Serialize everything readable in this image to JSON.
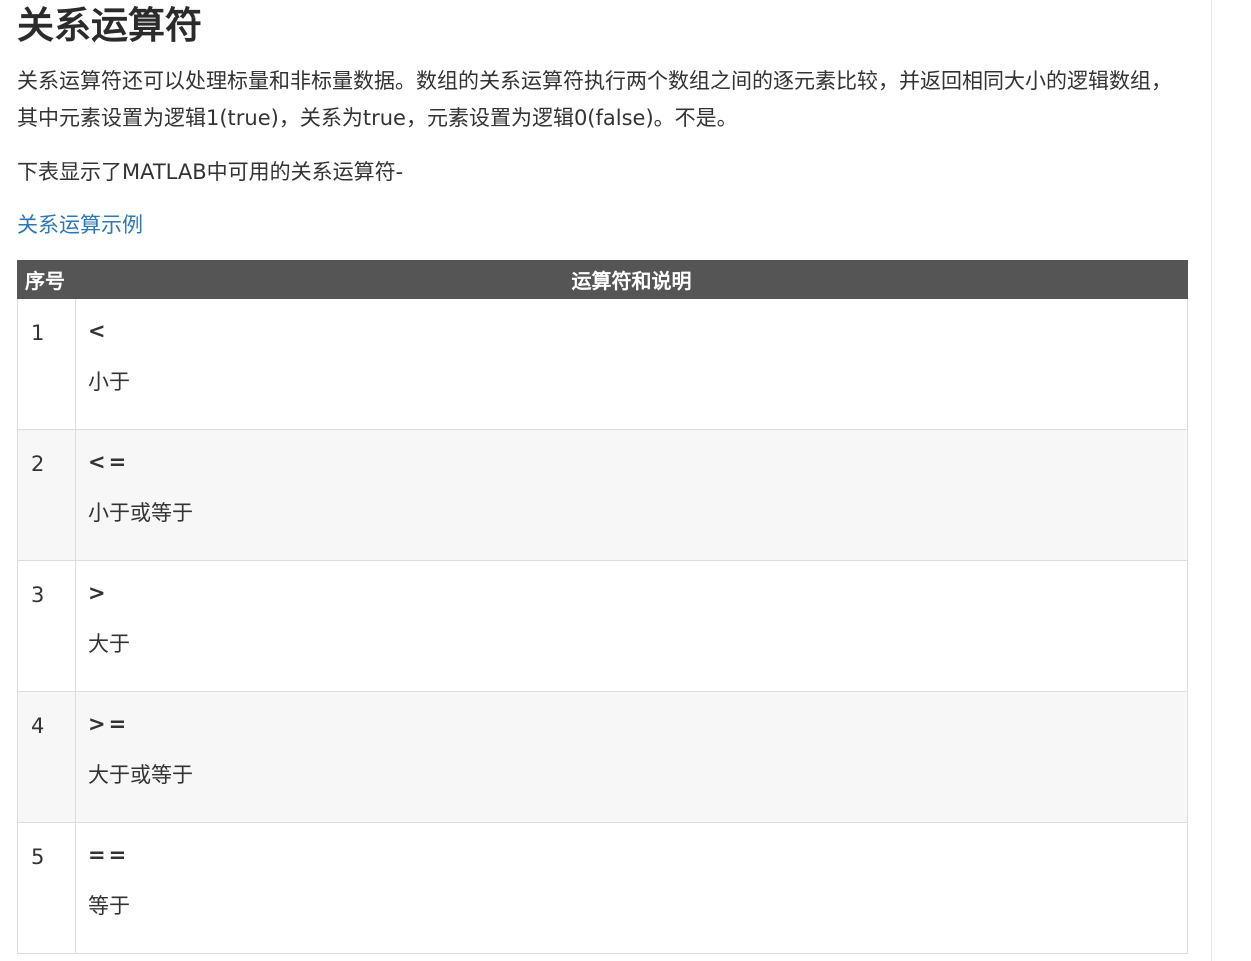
{
  "title": "关系运算符",
  "intro": "关系运算符还可以处理标量和非标量数据。数组的关系运算符执行两个数组之间的逐元素比较，并返回相同大小的逻辑数组，其中元素设置为逻辑1(true)，关系为true，元素设置为逻辑0(false)。不是。",
  "lead": "下表显示了MATLAB中可用的关系运算符-",
  "example_link": "关系运算示例",
  "table": {
    "headers": {
      "num": "序号",
      "desc": "运算符和说明"
    },
    "rows": [
      {
        "num": "1",
        "op": "<",
        "desc": "小于"
      },
      {
        "num": "2",
        "op": "<=",
        "desc": "小于或等于"
      },
      {
        "num": "3",
        "op": ">",
        "desc": "大于"
      },
      {
        "num": "4",
        "op": ">=",
        "desc": "大于或等于"
      },
      {
        "num": "5",
        "op": "==",
        "desc": "等于"
      }
    ]
  }
}
